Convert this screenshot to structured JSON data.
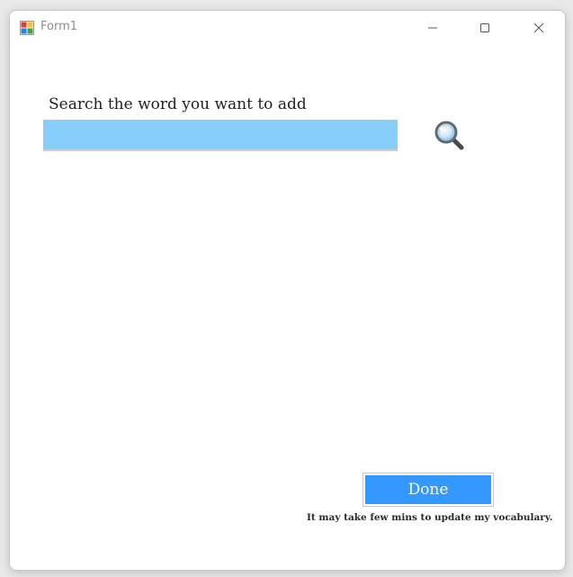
{
  "window": {
    "title": "Form1",
    "icon": "winforms-app-icon",
    "controls": {
      "minimize": "minimize-icon",
      "maximize": "maximize-icon",
      "close": "close-icon"
    }
  },
  "search": {
    "label": "Search the word you want to add",
    "value": "",
    "placeholder": "",
    "button_icon": "magnifier-icon"
  },
  "footer": {
    "done_label": "Done",
    "note": "It may take few mins to update my vocabulary."
  },
  "colors": {
    "input_background": "#87cefa",
    "done_background": "#3399ff",
    "window_background": "#ffffff"
  }
}
